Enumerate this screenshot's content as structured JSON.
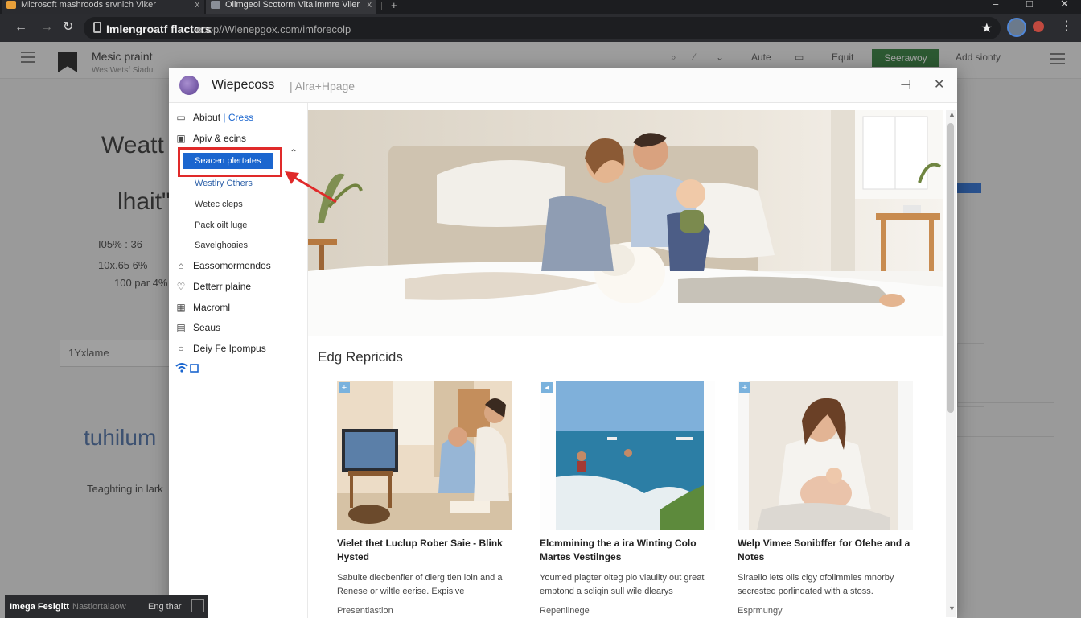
{
  "browser": {
    "tabs": [
      {
        "title": "Microsoft mashroods srvnich Viker"
      },
      {
        "title": "Oilmgeol Scotorm Vitalimmre Viler"
      }
    ],
    "new_tab": "+",
    "tab_close": "x",
    "address_host": "Imlengroatf flactors",
    "address_path": "ecop//Wlenepgox.com/imforecolp"
  },
  "background_page": {
    "title": "Mesic praint",
    "subtitle": "Wes Wetsf Siadu",
    "toolbar": {
      "item1": "Aute",
      "item2": "Equit",
      "primary": "Seerawoy",
      "item3": "Add sionty"
    },
    "heading_line1": "Weatt",
    "heading_line3": "lhait\"",
    "meta1": "I05% : 36",
    "meta2": "10x.65 6%",
    "meta3": "100 par 4%",
    "input_value": "1Yxlame",
    "brand_text": "tuhilum",
    "body_text": "Teaghting in lark"
  },
  "modal": {
    "title": "Wiepecoss",
    "subtitle": "Alra+Hpage",
    "sidebar": {
      "top_items": [
        {
          "label": "Abiout",
          "accent": "Cress"
        },
        {
          "label": "Apiv & ecins"
        }
      ],
      "sub_items": [
        {
          "label": "Seacen plertates",
          "active": true
        },
        {
          "label": "Westlry Cthers"
        },
        {
          "label": "Wetec cleps"
        },
        {
          "label": "Pack oilt luge"
        },
        {
          "label": "Savelghoaies"
        }
      ],
      "bottom_items": [
        {
          "label": "Eassomormendos"
        },
        {
          "label": "Detterr plaine"
        },
        {
          "label": "Macroml"
        },
        {
          "label": "Seaus"
        },
        {
          "label": "Deiy Fe Ipompus"
        }
      ]
    },
    "section_title": "Edg Repricids",
    "cards": [
      {
        "title": "Vielet thet Luclup Rober Saie - Blink Hysted",
        "desc": "Sabuite dlecbenfier of dlerg tien loin and a Renese or wiltle eerise. Expisive",
        "meta": "Presentlastion"
      },
      {
        "title": "Elcmmining the a ira Winting Colo Martes Vestilnges",
        "desc": "Youmed plagter olteg pio viaulity out great emptond a scliqin sull wile dlearys",
        "meta": "Repenlinege"
      },
      {
        "title": "Welp Vimee Sonibffer for Ofehe and a Notes",
        "desc": "Siraelio lets olls cigy ofolimmies mnorby secrested porlindated with a stoss.",
        "meta": "Esprmungy"
      }
    ]
  },
  "statusbar": {
    "label1": "Imega Feslgitt",
    "label2": "Nastlortalaow",
    "label3": "Eng thar"
  },
  "colors": {
    "accent_blue": "#1b66cf",
    "highlight_red": "#e02a2a",
    "primary_green": "#2f7d3a"
  }
}
